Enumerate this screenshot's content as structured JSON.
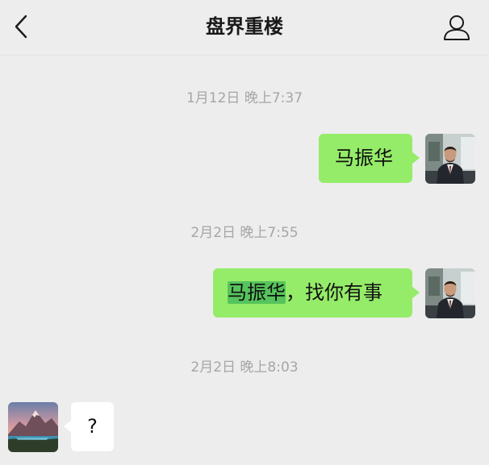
{
  "header": {
    "title": "盘界重楼",
    "back_icon": "chevron-left-icon",
    "profile_icon": "person-icon"
  },
  "messages": [
    {
      "timestamp": "1月12日 晚上7:37",
      "direction": "sent",
      "text": "马振华"
    },
    {
      "timestamp": "2月2日 晚上7:55",
      "direction": "sent",
      "highlight": "马振华",
      "rest": "，找你有事"
    },
    {
      "timestamp": "2月2日 晚上8:03",
      "direction": "received",
      "text": "?"
    }
  ],
  "colors": {
    "background": "#ededed",
    "sent_bubble": "#95ec69",
    "received_bubble": "#ffffff",
    "search_highlight": "#56c45c",
    "timestamp": "#a6a6a6"
  }
}
